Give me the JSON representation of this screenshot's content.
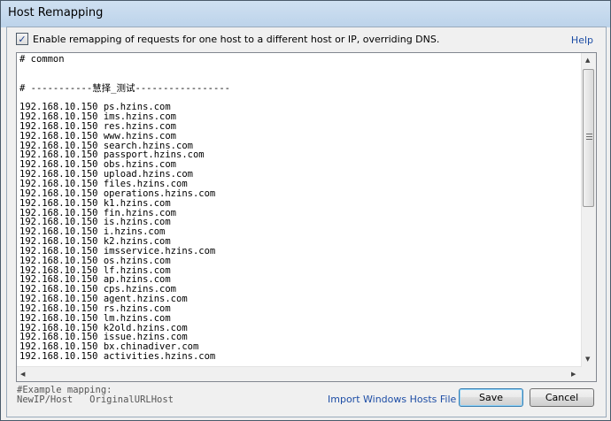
{
  "window": {
    "title": "Host Remapping"
  },
  "options": {
    "enable_checked": true,
    "enable_mark": "✓",
    "enable_label": "Enable remapping of requests for one host to a different host or IP, overriding DNS.",
    "help_label": "Help"
  },
  "editor": {
    "text": "# common\n\n\n# -----------慧择_测试-----------------\n\n192.168.10.150 ps.hzins.com\n192.168.10.150 ims.hzins.com\n192.168.10.150 res.hzins.com\n192.168.10.150 www.hzins.com\n192.168.10.150 search.hzins.com\n192.168.10.150 passport.hzins.com\n192.168.10.150 obs.hzins.com\n192.168.10.150 upload.hzins.com\n192.168.10.150 files.hzins.com\n192.168.10.150 operations.hzins.com\n192.168.10.150 k1.hzins.com\n192.168.10.150 fin.hzins.com\n192.168.10.150 is.hzins.com\n192.168.10.150 i.hzins.com\n192.168.10.150 k2.hzins.com\n192.168.10.150 imsservice.hzins.com\n192.168.10.150 os.hzins.com\n192.168.10.150 lf.hzins.com\n192.168.10.150 ap.hzins.com\n192.168.10.150 cps.hzins.com\n192.168.10.150 agent.hzins.com\n192.168.10.150 rs.hzins.com\n192.168.10.150 lm.hzins.com\n192.168.10.150 k2old.hzins.com\n192.168.10.150 issue.hzins.com\n192.168.10.150 bx.chinadiver.com\n192.168.10.150 activities.hzins.com"
  },
  "footer": {
    "example": "#Example mapping:\nNewIP/Host   OriginalURLHost",
    "import_label": "Import Windows Hosts File",
    "save_label": "Save",
    "cancel_label": "Cancel"
  },
  "icons": {
    "scroll_up": "▲",
    "scroll_down": "▼",
    "scroll_left": "◀",
    "scroll_right": "▶"
  }
}
